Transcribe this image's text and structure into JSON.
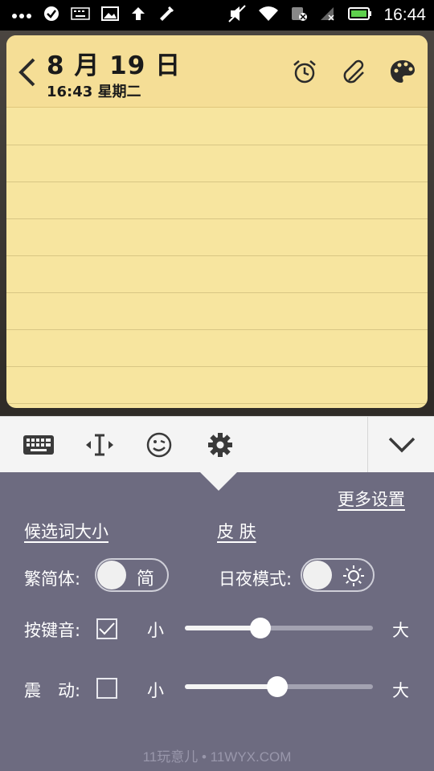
{
  "status_bar": {
    "time": "16:44",
    "icons": [
      "more-icon",
      "check-circle-icon",
      "keyboard-icon",
      "image-icon",
      "upload-arrow-icon",
      "tools-icon",
      "mute-icon",
      "wifi-icon",
      "sim-icon",
      "signal-icon",
      "battery-icon"
    ]
  },
  "note": {
    "date": "8 月 19 日",
    "time": "16:43 星期二"
  },
  "toolbar": {
    "buttons": [
      "keyboard-icon",
      "cursor-icon",
      "emoji-icon",
      "gear-icon",
      "chevron-down-icon"
    ]
  },
  "settings": {
    "more_settings": "更多设置",
    "candidate_size": "候选词大小",
    "skin": "皮 肤",
    "traditional_simplified_label": "繁简体:",
    "traditional_simplified_value": "简",
    "day_night_label": "日夜模式:",
    "key_sound_label": "按键音:",
    "key_sound_checked": true,
    "key_sound_level": 0.4,
    "vibrate_label": "震　动:",
    "vibrate_checked": false,
    "vibrate_level": 0.49,
    "small_label": "小",
    "large_label": "大"
  },
  "watermark": "11玩意儿 • 11WYX.COM",
  "colors": {
    "note_paper": "#f7e59f",
    "panel": "#6d6b80",
    "toolbar": "#f4f4f4"
  }
}
